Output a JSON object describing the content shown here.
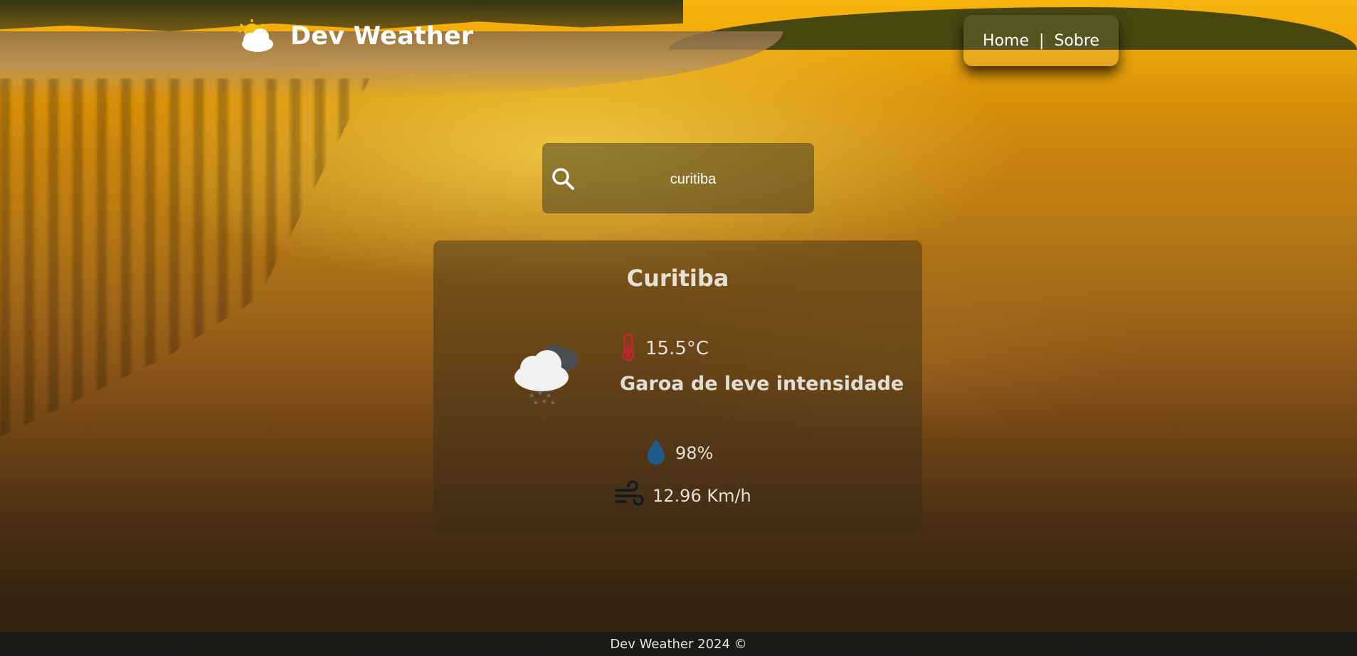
{
  "header": {
    "logo_title": "Dev Weather",
    "logo_icon": "sun-cloud-icon",
    "nav": {
      "home_label": "Home",
      "separator": "|",
      "about_label": "Sobre"
    }
  },
  "search": {
    "value": "curitiba",
    "icon": "search-icon"
  },
  "weather": {
    "city": "Curitiba",
    "icon": "rain-cloud-icon",
    "temperature": "15.5°C",
    "temperature_icon": "thermometer-icon",
    "description": "Garoa de leve intensidade",
    "humidity": "98%",
    "humidity_icon": "water-drop-icon",
    "wind": "12.96 Km/h",
    "wind_icon": "wind-icon"
  },
  "footer": {
    "text": "Dev Weather 2024 ©"
  },
  "colors": {
    "thermometer": "#c2272d",
    "drop": "#1f5b8c",
    "wind": "#0f1a26",
    "text": "#e6e0d6"
  }
}
